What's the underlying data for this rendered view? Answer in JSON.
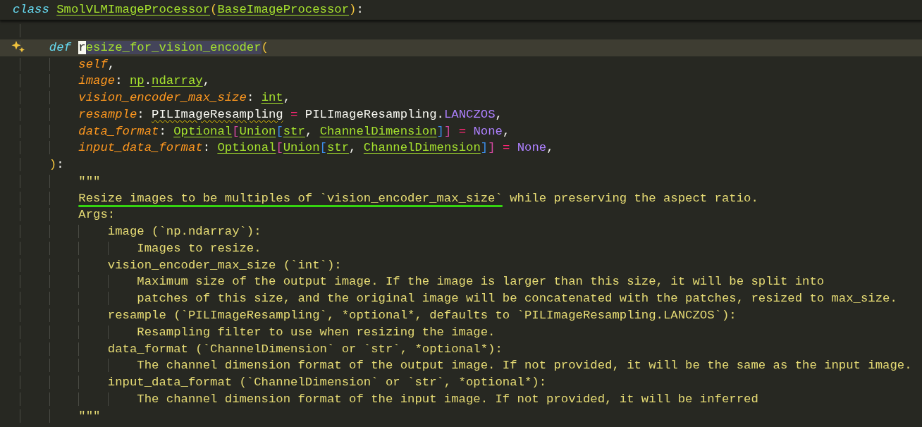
{
  "sticky_header": {
    "tokens": [
      {
        "kind": "keyword",
        "text": "class "
      },
      {
        "kind": "name",
        "text": "SmolVLMImageProcessor"
      },
      {
        "kind": "paren",
        "text": "("
      },
      {
        "kind": "name",
        "text": "BaseImageProcessor"
      },
      {
        "kind": "paren",
        "text": ")"
      },
      {
        "kind": "punct",
        "text": ":"
      }
    ]
  },
  "lines": [
    {
      "kind": "blank",
      "current": false
    },
    {
      "kind": "code",
      "current": true,
      "tokens": [
        {
          "kind": "keyword",
          "text": "def "
        },
        {
          "kind": "cursor",
          "text": "r"
        },
        {
          "kind": "selection",
          "text": "esize_for_vision_encoder"
        },
        {
          "kind": "paren",
          "text": "("
        }
      ],
      "children": [
        {
          "kind": "code",
          "current": false,
          "tokens": [
            {
              "kind": "param",
              "text": "self"
            },
            {
              "kind": "punct",
              "text": ","
            }
          ]
        },
        {
          "kind": "code",
          "current": false,
          "tokens": [
            {
              "kind": "param",
              "text": "image"
            },
            {
              "kind": "punct",
              "text": ": "
            },
            {
              "kind": "name",
              "text": "np"
            },
            {
              "kind": "punct",
              "text": "."
            },
            {
              "kind": "name",
              "text": "ndarray"
            },
            {
              "kind": "punct",
              "text": ","
            }
          ]
        },
        {
          "kind": "code",
          "current": false,
          "tokens": [
            {
              "kind": "param",
              "text": "vision_encoder_max_size"
            },
            {
              "kind": "punct",
              "text": ": "
            },
            {
              "kind": "name",
              "text": "int"
            },
            {
              "kind": "punct",
              "text": ","
            }
          ]
        },
        {
          "kind": "code",
          "current": false,
          "tokens": [
            {
              "kind": "param",
              "text": "resample"
            },
            {
              "kind": "punct",
              "text": ": "
            },
            {
              "kind": "warning",
              "text": "PILImageResampling"
            },
            {
              "kind": "operator",
              "text": " = "
            },
            {
              "kind": "punct",
              "text": "PILImageResampling."
            },
            {
              "kind": "constant",
              "text": "LANCZOS"
            },
            {
              "kind": "punct",
              "text": ","
            }
          ]
        },
        {
          "kind": "code",
          "current": false,
          "tokens": [
            {
              "kind": "param",
              "text": "data_format"
            },
            {
              "kind": "punct",
              "text": ": "
            },
            {
              "kind": "name",
              "text": "Optional"
            },
            {
              "kind": "bracket1",
              "text": "["
            },
            {
              "kind": "name",
              "text": "Union"
            },
            {
              "kind": "bracket2",
              "text": "["
            },
            {
              "kind": "name",
              "text": "str"
            },
            {
              "kind": "punct",
              "text": ", "
            },
            {
              "kind": "name",
              "text": "ChannelDimension"
            },
            {
              "kind": "bracket2",
              "text": "]"
            },
            {
              "kind": "bracket1",
              "text": "]"
            },
            {
              "kind": "operator",
              "text": " = "
            },
            {
              "kind": "constant",
              "text": "None"
            },
            {
              "kind": "punct",
              "text": ","
            }
          ]
        },
        {
          "kind": "code",
          "current": false,
          "tokens": [
            {
              "kind": "param",
              "text": "input_data_format"
            },
            {
              "kind": "punct",
              "text": ": "
            },
            {
              "kind": "name",
              "text": "Optional"
            },
            {
              "kind": "bracket1",
              "text": "["
            },
            {
              "kind": "name",
              "text": "Union"
            },
            {
              "kind": "bracket2",
              "text": "["
            },
            {
              "kind": "name",
              "text": "str"
            },
            {
              "kind": "punct",
              "text": ", "
            },
            {
              "kind": "name",
              "text": "ChannelDimension"
            },
            {
              "kind": "bracket2",
              "text": "]"
            },
            {
              "kind": "bracket1",
              "text": "]"
            },
            {
              "kind": "operator",
              "text": " = "
            },
            {
              "kind": "constant",
              "text": "None"
            },
            {
              "kind": "punct",
              "text": ","
            }
          ]
        }
      ]
    },
    {
      "kind": "code",
      "current": false,
      "tokens": [
        {
          "kind": "paren",
          "text": ")"
        },
        {
          "kind": "punct",
          "text": ":"
        }
      ],
      "children": [
        {
          "kind": "code",
          "current": false,
          "tokens": [
            {
              "kind": "doc",
              "text": "\"\"\""
            }
          ]
        },
        {
          "kind": "code",
          "current": false,
          "tokens": [
            {
              "kind": "doc-marked",
              "text": "Resize images to be multiples of `vision_encoder_max_size`"
            },
            {
              "kind": "doc",
              "text": " while preserving the aspect ratio."
            }
          ]
        },
        {
          "kind": "code",
          "current": false,
          "tokens": [
            {
              "kind": "doc",
              "text": "Args:"
            }
          ],
          "children": [
            {
              "kind": "code",
              "current": false,
              "tokens": [
                {
                  "kind": "doc",
                  "text": "image (`np.ndarray`):"
                }
              ],
              "children": [
                {
                  "kind": "code",
                  "current": false,
                  "tokens": [
                    {
                      "kind": "doc",
                      "text": "Images to resize."
                    }
                  ]
                }
              ]
            },
            {
              "kind": "code",
              "current": false,
              "tokens": [
                {
                  "kind": "doc",
                  "text": "vision_encoder_max_size (`int`):"
                }
              ],
              "children": [
                {
                  "kind": "code",
                  "current": false,
                  "tokens": [
                    {
                      "kind": "doc",
                      "text": "Maximum size of the output image. If the image is larger than this size, it will be split into"
                    }
                  ]
                },
                {
                  "kind": "code",
                  "current": false,
                  "tokens": [
                    {
                      "kind": "doc",
                      "text": "patches of this size, and the original image will be concatenated with the patches, resized to max_size."
                    }
                  ]
                }
              ]
            },
            {
              "kind": "code",
              "current": false,
              "tokens": [
                {
                  "kind": "doc",
                  "text": "resample (`PILImageResampling`, *optional*, defaults to `PILImageResampling.LANCZOS`):"
                }
              ],
              "children": [
                {
                  "kind": "code",
                  "current": false,
                  "tokens": [
                    {
                      "kind": "doc",
                      "text": "Resampling filter to use when resizing the image."
                    }
                  ]
                }
              ]
            },
            {
              "kind": "code",
              "current": false,
              "tokens": [
                {
                  "kind": "doc",
                  "text": "data_format (`ChannelDimension` or `str`, *optional*):"
                }
              ],
              "children": [
                {
                  "kind": "code",
                  "current": false,
                  "tokens": [
                    {
                      "kind": "doc",
                      "text": "The channel dimension format of the output image. If not provided, it will be the same as the input image."
                    }
                  ]
                }
              ]
            },
            {
              "kind": "code",
              "current": false,
              "tokens": [
                {
                  "kind": "doc",
                  "text": "input_data_format (`ChannelDimension` or `str`, *optional*):"
                }
              ],
              "children": [
                {
                  "kind": "code",
                  "current": false,
                  "tokens": [
                    {
                      "kind": "doc",
                      "text": "The channel dimension format of the input image. If not provided, it will be inferred"
                    }
                  ]
                }
              ]
            }
          ]
        },
        {
          "kind": "code",
          "current": false,
          "tokens": [
            {
              "kind": "doc",
              "text": "\"\"\""
            }
          ]
        }
      ]
    }
  ]
}
